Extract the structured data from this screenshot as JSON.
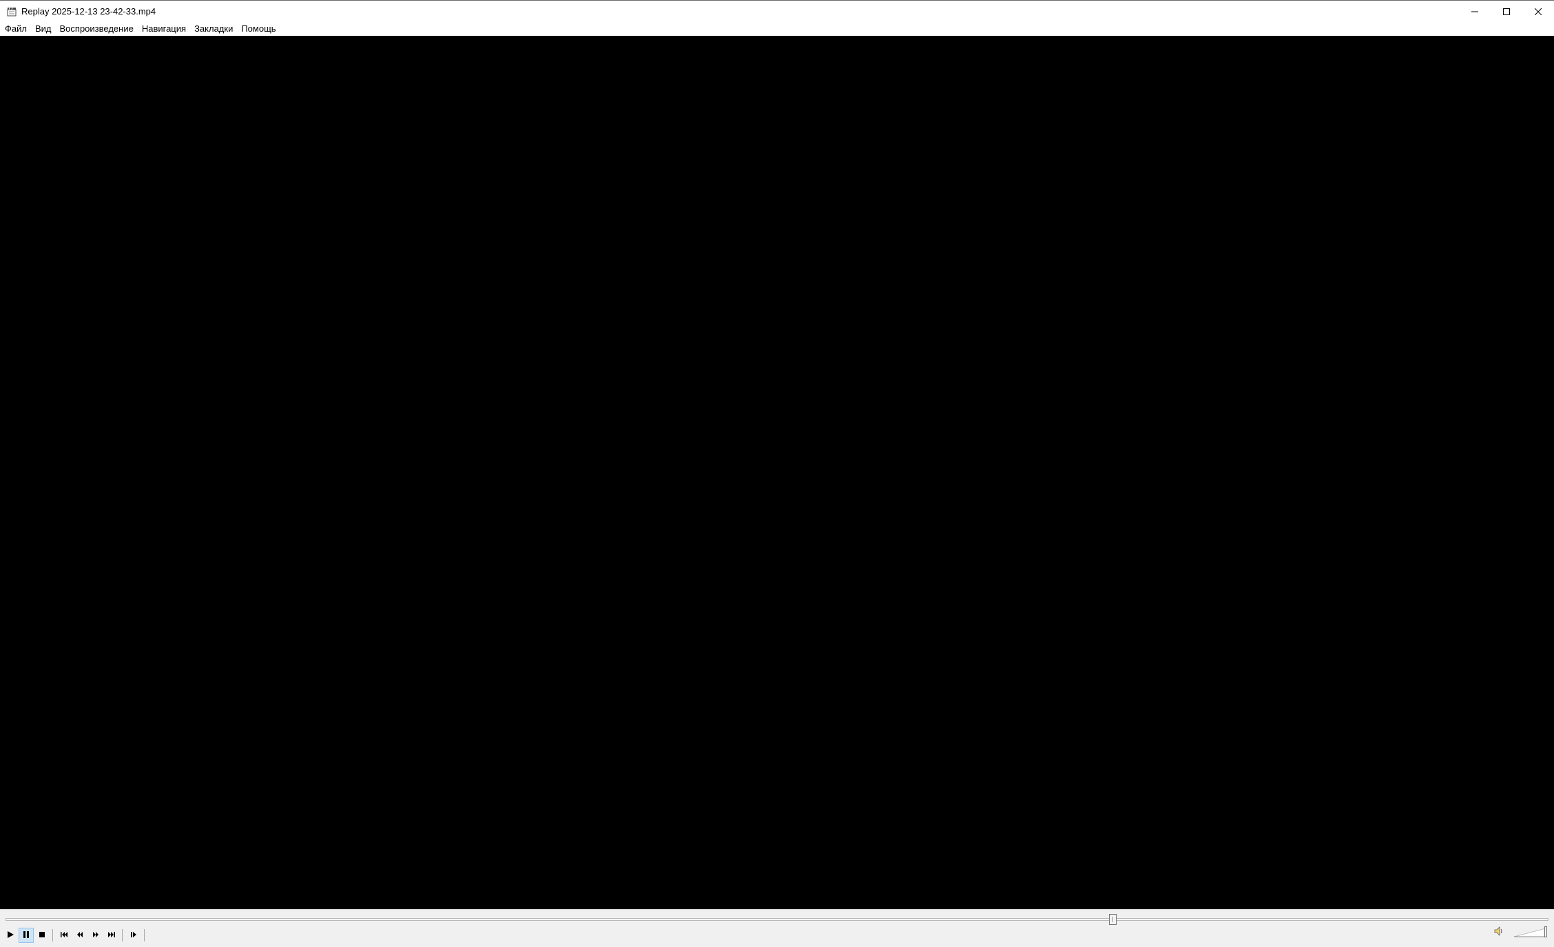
{
  "window": {
    "title": "Replay 2025-12-13 23-42-33.mp4",
    "icon": "film-clapper-icon",
    "caption_buttons": [
      "minimize-icon",
      "maximize-icon",
      "close-icon"
    ]
  },
  "menu": {
    "items": [
      {
        "label": "Файл"
      },
      {
        "label": "Вид"
      },
      {
        "label": "Воспроизведение"
      },
      {
        "label": "Навигация"
      },
      {
        "label": "Закладки"
      },
      {
        "label": "Помощь"
      }
    ]
  },
  "player": {
    "seek_position": 0.718,
    "volume_level": 1.0,
    "state": "paused",
    "toolbar": [
      {
        "icon": "play-icon"
      },
      {
        "icon": "pause-icon",
        "active": true
      },
      {
        "icon": "stop-icon"
      },
      {
        "icon": "previous-icon"
      },
      {
        "icon": "rewind-icon"
      },
      {
        "icon": "fast-forward-icon"
      },
      {
        "icon": "next-icon"
      },
      {
        "icon": "frame-step-icon"
      }
    ],
    "volume_icon": "speaker-icon"
  },
  "colors": {
    "video_background": "#000000",
    "panel_background": "#f0f0f0",
    "active_button": "#cde4f7"
  }
}
